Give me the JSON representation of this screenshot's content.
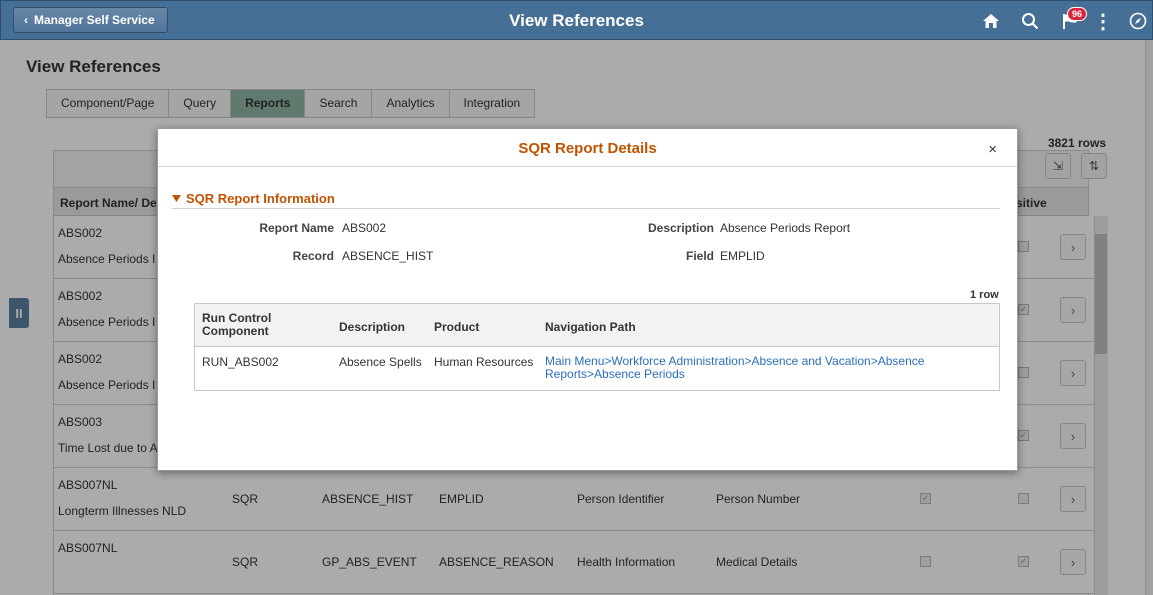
{
  "header": {
    "back_label": "Manager Self Service",
    "title": "View References",
    "notification_count": "96",
    "colors": {
      "bar": "#456f95",
      "accent": "#c05300"
    },
    "icons": [
      "back-chevron-icon",
      "home-icon",
      "search-icon",
      "notification-flag-icon",
      "more-options-icon",
      "navbar-compass-icon"
    ]
  },
  "page": {
    "title": "View References",
    "tabs": [
      "Component/Page",
      "Query",
      "Reports",
      "Search",
      "Analytics",
      "Integration"
    ],
    "active_tab": "Reports",
    "row_count": "3821 rows"
  },
  "grid": {
    "headers": {
      "report_name": "Report Name/ De",
      "sensitive": "sitive"
    },
    "rows": [
      {
        "name": "ABS002",
        "desc": "Absence Periods I",
        "type": "",
        "record": "",
        "field": "",
        "category": "",
        "label": "",
        "check1": false,
        "check2": false
      },
      {
        "name": "ABS002",
        "desc": "Absence Periods I",
        "type": "",
        "record": "",
        "field": "",
        "category": "",
        "label": "",
        "check1": false,
        "check2": true
      },
      {
        "name": "ABS002",
        "desc": "Absence Periods I",
        "type": "",
        "record": "",
        "field": "",
        "category": "",
        "label": "",
        "check1": false,
        "check2": false
      },
      {
        "name": "ABS003",
        "desc": "Time Lost due to A",
        "type": "",
        "record": "",
        "field": "",
        "category": "",
        "label": "",
        "check1": false,
        "check2": true
      },
      {
        "name": "ABS007NL",
        "desc": "Longterm Illnesses NLD",
        "type": "SQR",
        "record": "ABSENCE_HIST",
        "field": "EMPLID",
        "category": "Person Identifier",
        "label": "Person Number",
        "check1": true,
        "check2": false
      },
      {
        "name": "ABS007NL",
        "desc": "",
        "type": "SQR",
        "record": "GP_ABS_EVENT",
        "field": "ABSENCE_REASON",
        "category": "Health Information",
        "label": "Medical Details",
        "check1": false,
        "check2": true
      }
    ]
  },
  "modal": {
    "title": "SQR Report Details",
    "close_label": "×",
    "section_title": "SQR Report Information",
    "fields": {
      "report_name_label": "Report Name",
      "report_name_value": "ABS002",
      "description_label": "Description",
      "description_value": "Absence Periods Report",
      "record_label": "Record",
      "record_value": "ABSENCE_HIST",
      "field_label": "Field",
      "field_value": "EMPLID"
    },
    "inner_row_count": "1 row",
    "table": {
      "headers": {
        "run_control": "Run Control Component",
        "description": "Description",
        "product": "Product",
        "navigation": "Navigation Path"
      },
      "rows": [
        {
          "run_control": "RUN_ABS002",
          "description": "Absence Spells",
          "product": "Human Resources",
          "navigation": "Main Menu>Workforce Administration>Absence and Vacation>Absence Reports>Absence Periods"
        }
      ]
    }
  }
}
